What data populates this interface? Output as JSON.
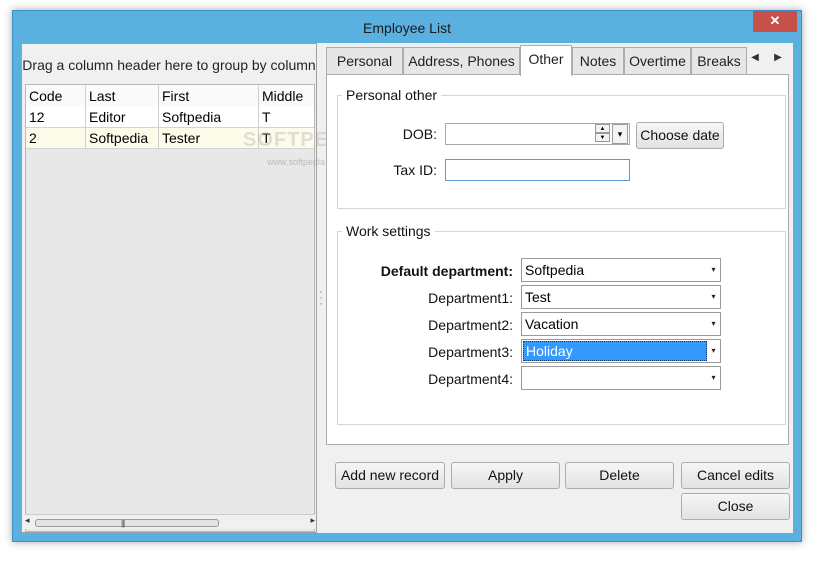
{
  "window": {
    "title": "Employee List",
    "close_glyph": "✕"
  },
  "grid": {
    "group_hint": "Drag a column header here to group by column",
    "columns": [
      "Code",
      "Last",
      "First",
      "Middle"
    ],
    "rows": [
      [
        "12",
        "Editor",
        "Softpedia",
        "T"
      ],
      [
        "2",
        "Softpedia",
        "Tester",
        "T"
      ]
    ]
  },
  "tabs": {
    "items": [
      "Personal",
      "Address, Phones",
      "Other",
      "Notes",
      "Overtime",
      "Breaks"
    ],
    "active": "Other",
    "scroll_left_glyph": "◀",
    "scroll_right_glyph": "▶"
  },
  "personal_other": {
    "legend": "Personal other",
    "dob_label": "DOB:",
    "dob_value": "",
    "choose_date_label": "Choose date",
    "tax_label": "Tax ID:",
    "tax_value": ""
  },
  "work_settings": {
    "legend": "Work settings",
    "fields": [
      {
        "label": "Default department:",
        "value": "Softpedia"
      },
      {
        "label": "Department1:",
        "value": "Test"
      },
      {
        "label": "Department2:",
        "value": "Vacation"
      },
      {
        "label": "Department3:",
        "value": "Holiday"
      },
      {
        "label": "Department4:",
        "value": ""
      }
    ]
  },
  "buttons": {
    "add": "Add new record",
    "apply": "Apply",
    "delete": "Delete",
    "cancel": "Cancel edits",
    "close": "Close"
  },
  "watermark": {
    "main": "SOFTPEDIA",
    "url": "www.softpedia.com"
  },
  "icons": {
    "close": "close-icon",
    "spin": "spin-updown-icon",
    "dropdown": "chevron-down-icon",
    "tab_left": "chevron-left-icon",
    "tab_right": "chevron-right-icon"
  },
  "colors": {
    "frame": "#5ab1e0",
    "close_button": "#c7504b",
    "selection": "#3399ff",
    "row_highlight": "#fdfbea"
  }
}
